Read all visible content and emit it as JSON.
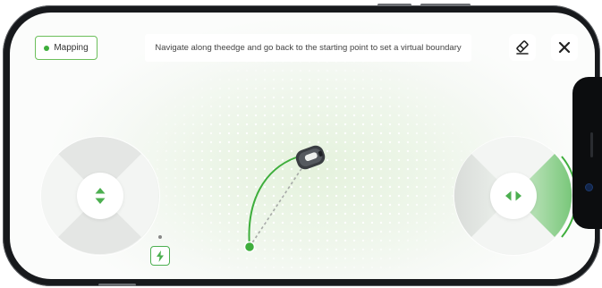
{
  "header": {
    "mode_label": "Mapping",
    "instruction": "Navigate along theedge and go back to the starting point to set a virtual boundary"
  },
  "toolbar": {
    "eraser_icon": "eraser-icon",
    "close_icon": "close-icon"
  },
  "controls": {
    "left_joystick_icon": "up-down-arrows-icon",
    "right_joystick_icon": "left-right-arrows-icon",
    "charging_icon": "lightning-icon"
  },
  "colors": {
    "accent_green": "#4caf50",
    "path_green": "#3eae3c",
    "mower_body": "#3a3d42"
  }
}
